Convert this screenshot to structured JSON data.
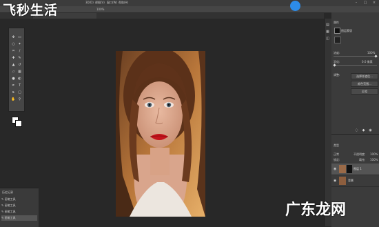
{
  "watermark_top": "飞秒生活",
  "watermark_bottom": "广东龙网",
  "menubar": {
    "items": [
      "3D(D)",
      "视图(V)",
      "窗口(W)",
      "帮助(H)"
    ]
  },
  "options_bar": {
    "zoom": "100%"
  },
  "document_tab": "...",
  "history": {
    "title": "历史记录",
    "items": [
      "画笔工具",
      "画笔工具",
      "画笔工具",
      "画笔工具"
    ]
  },
  "properties": {
    "title": "属性",
    "mask_label": "图层蒙版",
    "density_label": "浓度:",
    "density_value": "100%",
    "feather_label": "羽化:",
    "feather_value": "0.0 像素",
    "adjust_label": "调整:",
    "btn_select_mask": "选择并遮住...",
    "btn_color_range": "颜色范围...",
    "btn_invert": "反相"
  },
  "layers": {
    "kind": "类型",
    "blend": "正常",
    "opacity_label": "不透明度:",
    "opacity_value": "100%",
    "lock_label": "锁定:",
    "fill_label": "填充:",
    "fill_value": "100%",
    "rows": [
      {
        "name": "图层 1"
      },
      {
        "name": "背景"
      }
    ]
  },
  "colors": {
    "accent": "#2d8ce8",
    "panel": "#3b3b3b",
    "canvas_bg": "#282828"
  }
}
